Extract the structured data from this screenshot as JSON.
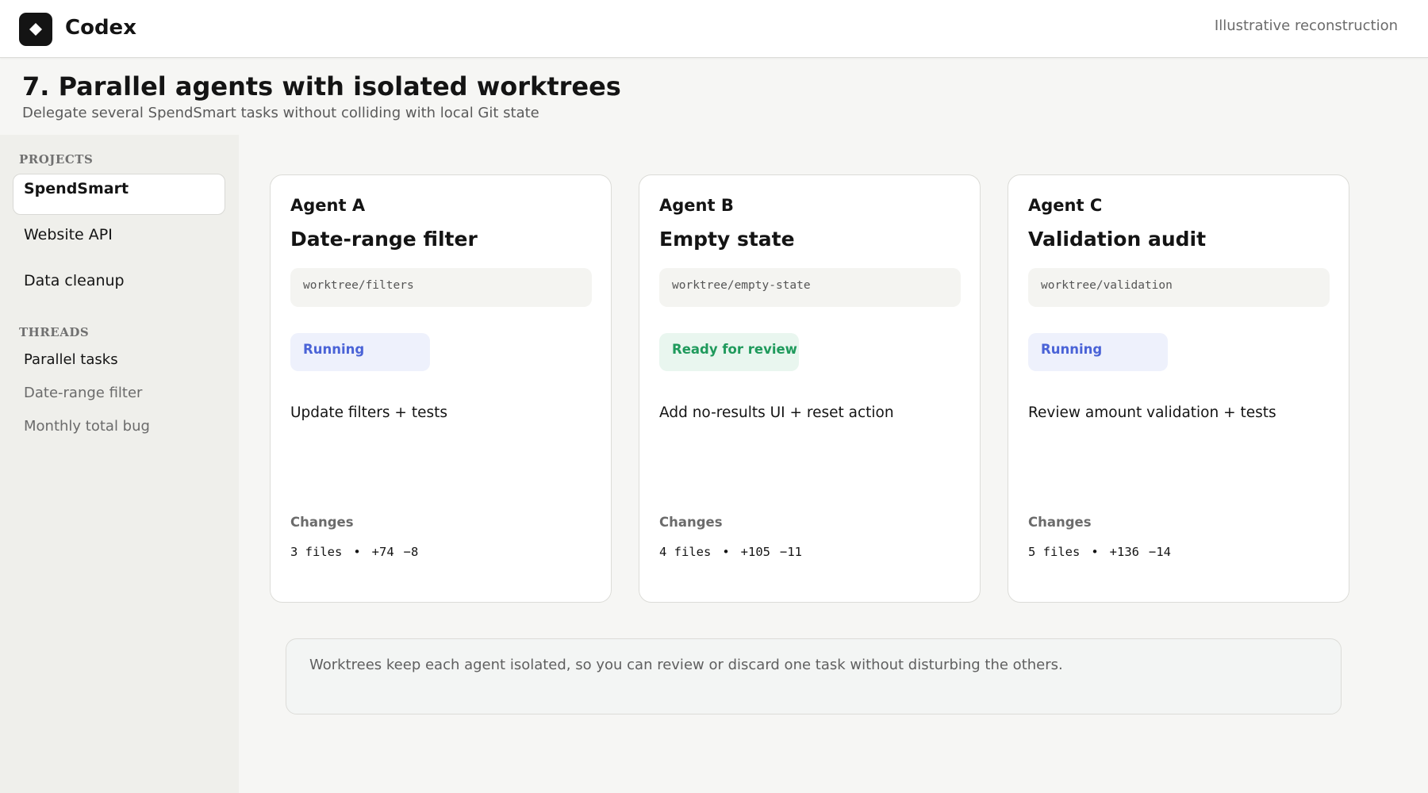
{
  "app": {
    "name": "Codex",
    "note": "Illustrative reconstruction"
  },
  "page": {
    "title": "7. Parallel agents with isolated worktrees",
    "subtitle": "Delegate several SpendSmart tasks without colliding with local Git state"
  },
  "sidebar": {
    "projects_label": "PROJECTS",
    "projects": [
      {
        "label": "SpendSmart",
        "active": true
      },
      {
        "label": "Website API",
        "active": false
      },
      {
        "label": "Data cleanup",
        "active": false
      }
    ],
    "threads_label": "THREADS",
    "threads": [
      {
        "label": "Parallel tasks"
      },
      {
        "label": "Date-range filter"
      },
      {
        "label": "Monthly total bug"
      }
    ]
  },
  "agents": [
    {
      "agent": "Agent A",
      "title": "Date-range filter",
      "worktree": "worktree/filters",
      "status": "Running",
      "status_type": "running",
      "task": "Update filters + tests",
      "changes_label": "Changes",
      "files": "3 files",
      "separator": "•",
      "additions": "+74",
      "deletions": "−8"
    },
    {
      "agent": "Agent B",
      "title": "Empty state",
      "worktree": "worktree/empty-state",
      "status": "Ready for review",
      "status_type": "ready",
      "task": "Add no-results UI + reset action",
      "changes_label": "Changes",
      "files": "4 files",
      "separator": "•",
      "additions": "+105",
      "deletions": "−11"
    },
    {
      "agent": "Agent C",
      "title": "Validation audit",
      "worktree": "worktree/validation",
      "status": "Running",
      "status_type": "running",
      "task": "Review amount validation + tests",
      "changes_label": "Changes",
      "files": "5 files",
      "separator": "•",
      "additions": "+136",
      "deletions": "−14"
    }
  ],
  "footer_note": "Worktrees keep each agent isolated, so you can review or discard one task without disturbing the others.",
  "colors": {
    "running_text": "#4a63d7",
    "running_bg": "#eef1fc",
    "ready_text": "#1f9a5c",
    "ready_bg": "#e9f6ef"
  },
  "icons": {
    "logo": "diamond-icon"
  }
}
